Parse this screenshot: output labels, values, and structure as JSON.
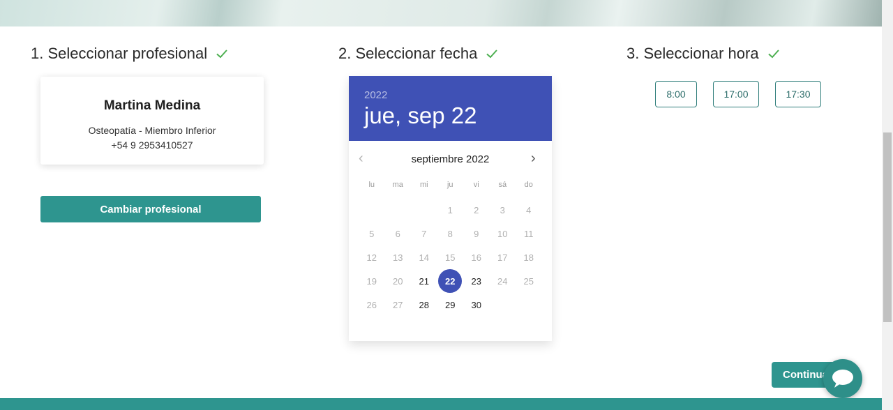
{
  "steps": {
    "professional": "1. Seleccionar profesional",
    "date": "2. Seleccionar fecha",
    "time": "3. Seleccionar hora"
  },
  "professional": {
    "name": "Martina Medina",
    "specialty": "Osteopatía - Miembro Inferior",
    "phone": "+54 9 2953410527",
    "change_label": "Cambiar profesional"
  },
  "calendar": {
    "year": "2022",
    "selected_date": "jue, sep 22",
    "month_label": "septiembre 2022",
    "weekdays": [
      "lu",
      "ma",
      "mi",
      "ju",
      "vi",
      "sá",
      "do"
    ],
    "leading_blanks": 3,
    "days": [
      "1",
      "2",
      "3",
      "4",
      "5",
      "6",
      "7",
      "8",
      "9",
      "10",
      "11",
      "12",
      "13",
      "14",
      "15",
      "16",
      "17",
      "18",
      "19",
      "20",
      "21",
      "22",
      "23",
      "24",
      "25",
      "26",
      "27",
      "28",
      "29",
      "30"
    ],
    "available": [
      "21",
      "23",
      "28",
      "29",
      "30"
    ],
    "selected": "22"
  },
  "times": [
    "8:00",
    "17:00",
    "17:30"
  ],
  "continue_label": "Continuar",
  "colors": {
    "accent": "#2e958f",
    "calendar_header": "#3f51b5",
    "check": "#4caf50"
  }
}
